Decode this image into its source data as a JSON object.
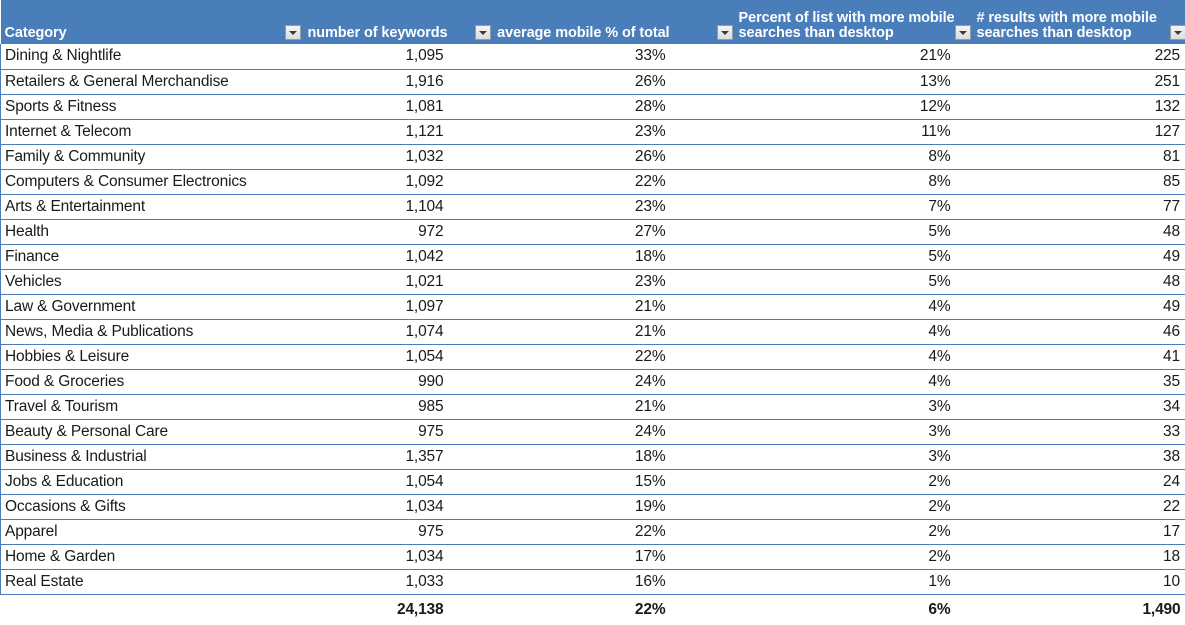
{
  "table": {
    "columns": [
      {
        "label_lines": [
          "Category"
        ],
        "has_filter": false,
        "align": "left"
      },
      {
        "label_lines": [
          "number of keywords"
        ],
        "has_filter": true,
        "align": "right"
      },
      {
        "label_lines": [
          "average mobile % of total"
        ],
        "has_filter": true,
        "align": "right"
      },
      {
        "label_lines": [
          "Percent of list with more mobile",
          "searches than desktop"
        ],
        "has_filter": true,
        "align": "right"
      },
      {
        "label_lines": [
          "# results with more mobile",
          "searches than desktop"
        ],
        "has_filter": true,
        "align": "right"
      }
    ],
    "filter_icon": "filter-dropdown-icon",
    "rows": [
      {
        "category": "Dining & Nightlife",
        "keywords": "1,095",
        "avg_mobile_pct": "33%",
        "pct_more_mobile": "21%",
        "results_more_mobile": "225"
      },
      {
        "category": "Retailers & General Merchandise",
        "keywords": "1,916",
        "avg_mobile_pct": "26%",
        "pct_more_mobile": "13%",
        "results_more_mobile": "251"
      },
      {
        "category": "Sports & Fitness",
        "keywords": "1,081",
        "avg_mobile_pct": "28%",
        "pct_more_mobile": "12%",
        "results_more_mobile": "132"
      },
      {
        "category": "Internet & Telecom",
        "keywords": "1,121",
        "avg_mobile_pct": "23%",
        "pct_more_mobile": "11%",
        "results_more_mobile": "127"
      },
      {
        "category": "Family & Community",
        "keywords": "1,032",
        "avg_mobile_pct": "26%",
        "pct_more_mobile": "8%",
        "results_more_mobile": "81"
      },
      {
        "category": "Computers & Consumer Electronics",
        "keywords": "1,092",
        "avg_mobile_pct": "22%",
        "pct_more_mobile": "8%",
        "results_more_mobile": "85"
      },
      {
        "category": "Arts & Entertainment",
        "keywords": "1,104",
        "avg_mobile_pct": "23%",
        "pct_more_mobile": "7%",
        "results_more_mobile": "77"
      },
      {
        "category": "Health",
        "keywords": "972",
        "avg_mobile_pct": "27%",
        "pct_more_mobile": "5%",
        "results_more_mobile": "48"
      },
      {
        "category": "Finance",
        "keywords": "1,042",
        "avg_mobile_pct": "18%",
        "pct_more_mobile": "5%",
        "results_more_mobile": "49"
      },
      {
        "category": "Vehicles",
        "keywords": "1,021",
        "avg_mobile_pct": "23%",
        "pct_more_mobile": "5%",
        "results_more_mobile": "48"
      },
      {
        "category": "Law & Government",
        "keywords": "1,097",
        "avg_mobile_pct": "21%",
        "pct_more_mobile": "4%",
        "results_more_mobile": "49"
      },
      {
        "category": "News, Media & Publications",
        "keywords": "1,074",
        "avg_mobile_pct": "21%",
        "pct_more_mobile": "4%",
        "results_more_mobile": "46"
      },
      {
        "category": "Hobbies & Leisure",
        "keywords": "1,054",
        "avg_mobile_pct": "22%",
        "pct_more_mobile": "4%",
        "results_more_mobile": "41"
      },
      {
        "category": "Food & Groceries",
        "keywords": "990",
        "avg_mobile_pct": "24%",
        "pct_more_mobile": "4%",
        "results_more_mobile": "35"
      },
      {
        "category": "Travel & Tourism",
        "keywords": "985",
        "avg_mobile_pct": "21%",
        "pct_more_mobile": "3%",
        "results_more_mobile": "34"
      },
      {
        "category": "Beauty & Personal Care",
        "keywords": "975",
        "avg_mobile_pct": "24%",
        "pct_more_mobile": "3%",
        "results_more_mobile": "33"
      },
      {
        "category": "Business & Industrial",
        "keywords": "1,357",
        "avg_mobile_pct": "18%",
        "pct_more_mobile": "3%",
        "results_more_mobile": "38"
      },
      {
        "category": "Jobs & Education",
        "keywords": "1,054",
        "avg_mobile_pct": "15%",
        "pct_more_mobile": "2%",
        "results_more_mobile": "24"
      },
      {
        "category": "Occasions & Gifts",
        "keywords": "1,034",
        "avg_mobile_pct": "19%",
        "pct_more_mobile": "2%",
        "results_more_mobile": "22"
      },
      {
        "category": "Apparel",
        "keywords": "975",
        "avg_mobile_pct": "22%",
        "pct_more_mobile": "2%",
        "results_more_mobile": "17"
      },
      {
        "category": "Home & Garden",
        "keywords": "1,034",
        "avg_mobile_pct": "17%",
        "pct_more_mobile": "2%",
        "results_more_mobile": "18"
      },
      {
        "category": "Real Estate",
        "keywords": "1,033",
        "avg_mobile_pct": "16%",
        "pct_more_mobile": "1%",
        "results_more_mobile": "10"
      }
    ],
    "total_row": {
      "category": "",
      "keywords": "24,138",
      "avg_mobile_pct": "22%",
      "pct_more_mobile": "6%",
      "results_more_mobile": "1,490"
    }
  },
  "colors": {
    "header_background": "#4A7EBB",
    "header_text": "#FFFFFF",
    "grid_line": "#4A7EBB",
    "body_text": "#1A1A1A",
    "cell_background": "#FFFFFF"
  }
}
